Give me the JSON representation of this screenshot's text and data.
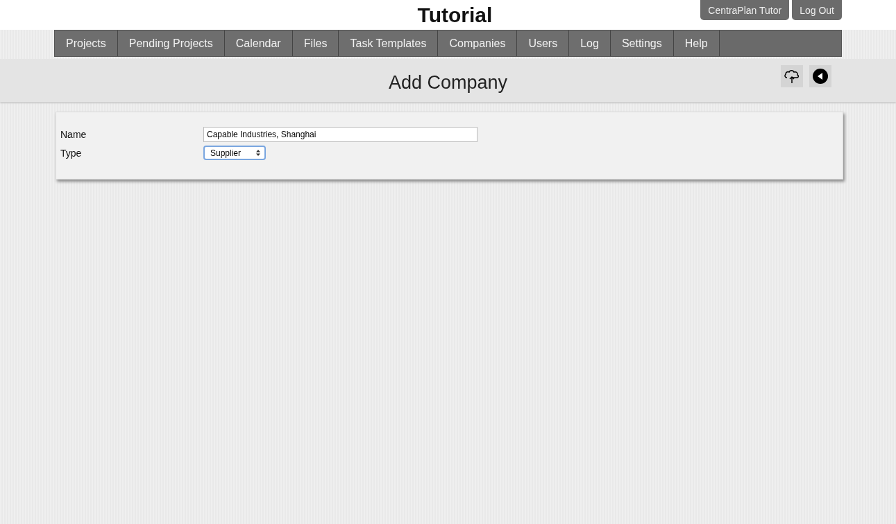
{
  "site_title": "Tutorial",
  "top_buttons": [
    "CentraPlan Tutor",
    "Log Out"
  ],
  "nav": [
    {
      "label": "Projects",
      "selected": false
    },
    {
      "label": "Pending Projects",
      "selected": false
    },
    {
      "label": "Calendar",
      "selected": false
    },
    {
      "label": "Files",
      "selected": false
    },
    {
      "label": "Task Templates",
      "selected": false
    },
    {
      "label": "Companies",
      "selected": false
    },
    {
      "label": "Users",
      "selected": false
    },
    {
      "label": "Log",
      "selected": false
    },
    {
      "label": "Settings",
      "selected": false
    },
    {
      "label": "Help",
      "selected": false
    }
  ],
  "page_title": "Add Company",
  "form": [
    {
      "kind": "text",
      "label": "Name",
      "value": "Capable Industries, Shanghai"
    },
    {
      "kind": "select",
      "label": "Type",
      "value": "Supplier"
    }
  ]
}
